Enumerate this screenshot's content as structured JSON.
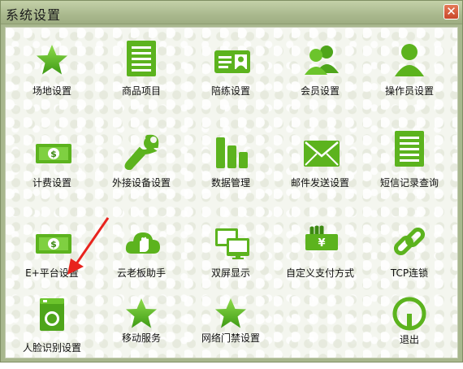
{
  "window": {
    "title": "系统设置",
    "close_glyph": "✕"
  },
  "items": [
    {
      "label": "场地设置",
      "icon": "star-icon"
    },
    {
      "label": "商品项目",
      "icon": "document-icon"
    },
    {
      "label": "陪练设置",
      "icon": "id-card-icon"
    },
    {
      "label": "会员设置",
      "icon": "users-icon"
    },
    {
      "label": "操作员设置",
      "icon": "user-icon"
    },
    {
      "label": "计费设置",
      "icon": "dollar-bill-icon"
    },
    {
      "label": "外接设备设置",
      "icon": "wrench-icon"
    },
    {
      "label": "数据管理",
      "icon": "bar-chart-icon"
    },
    {
      "label": "邮件发送设置",
      "icon": "mail-icon"
    },
    {
      "label": "短信记录查询",
      "icon": "document-icon"
    },
    {
      "label": "E+平台设置",
      "icon": "dollar-bill-icon"
    },
    {
      "label": "云老板助手",
      "icon": "cloud-hand-icon"
    },
    {
      "label": "双屏显示",
      "icon": "dual-monitor-icon"
    },
    {
      "label": "自定义支付方式",
      "icon": "cash-payment-icon"
    },
    {
      "label": "TCP连锁",
      "icon": "chain-link-icon"
    },
    {
      "label": "人脸识别设置",
      "icon": "face-scanner-icon"
    },
    {
      "label": "移动服务",
      "icon": "star-icon"
    },
    {
      "label": "网络门禁设置",
      "icon": "star-icon"
    },
    {
      "label": "退出",
      "icon": "power-icon"
    }
  ],
  "colors": {
    "accent": "#5cb31e",
    "accent_dark": "#3d8a12",
    "arrow": "#e8231d"
  }
}
